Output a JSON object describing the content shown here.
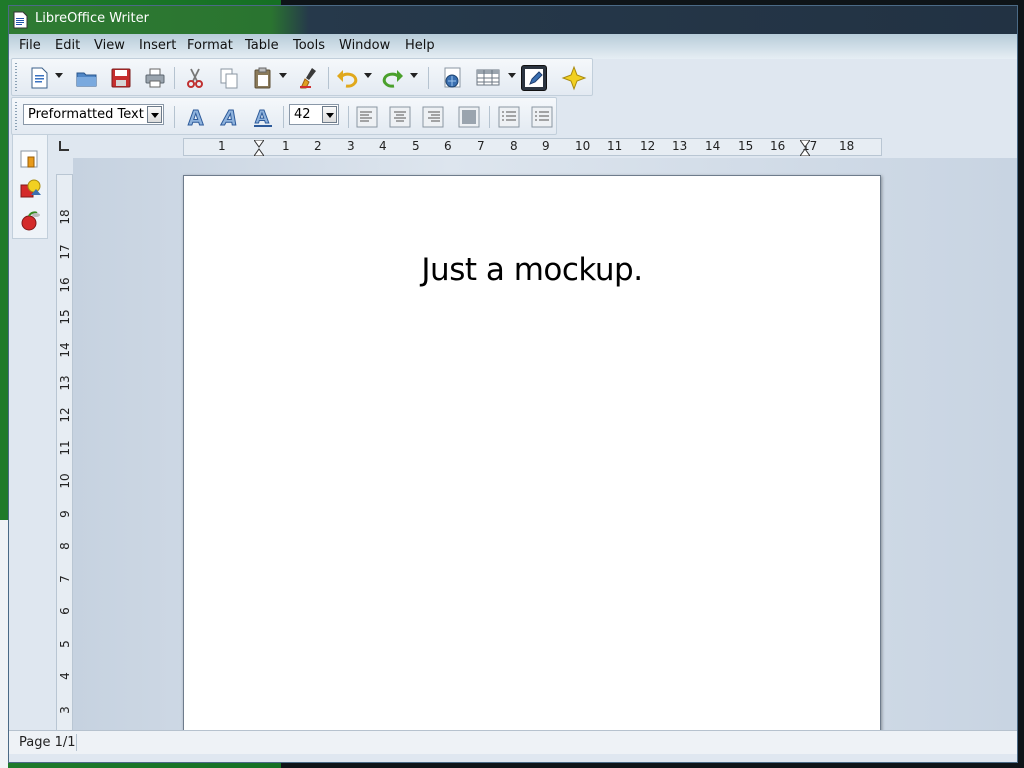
{
  "window": {
    "title": "LibreOffice Writer"
  },
  "menu": [
    "File",
    "Edit",
    "View",
    "Insert",
    "Format",
    "Table",
    "Tools",
    "Window",
    "Help"
  ],
  "toolbar_standard": {
    "buttons": [
      "new-document",
      "open",
      "save",
      "print",
      "cut",
      "copy",
      "paste",
      "clone-formatting",
      "undo",
      "redo",
      "navigator",
      "insert-table",
      "draw-functions",
      "gallery"
    ]
  },
  "formatting": {
    "paragraph_style": "Preformatted Text",
    "font_size": "42"
  },
  "rulers": {
    "horizontal_ticks": [
      "1",
      "1",
      "2",
      "3",
      "4",
      "5",
      "6",
      "7",
      "8",
      "9",
      "10",
      "11",
      "12",
      "13",
      "14",
      "15",
      "16",
      "17",
      "18"
    ],
    "vertical_ticks": [
      "18",
      "17",
      "16",
      "15",
      "14",
      "13",
      "12",
      "11",
      "10",
      "9",
      "8",
      "7",
      "6",
      "5",
      "4",
      "3"
    ]
  },
  "document": {
    "text": "Just a mockup."
  },
  "status": {
    "page": "Page 1/1"
  },
  "colors": {
    "title_bar": "#2a7430",
    "toolbar_bg": "#e9eff5",
    "page_bg": "#ffffff"
  }
}
